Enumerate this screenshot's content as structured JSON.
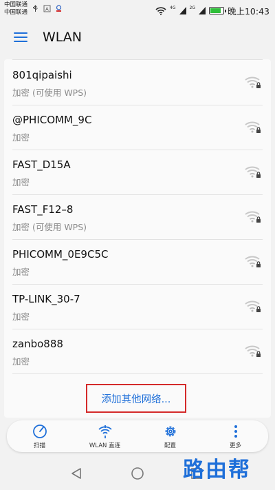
{
  "status_bar": {
    "carrier_1": "中国联通",
    "carrier_2": "中国联通",
    "signal_label_1": "4G",
    "signal_label_2": "2G",
    "time": "晚上10:43",
    "battery_level": 0.85,
    "colors": {
      "battery_fill": "#2fbf3a"
    }
  },
  "app_bar": {
    "title": "WLAN",
    "menu_icon": "hamburger-icon"
  },
  "networks": [
    {
      "ssid": "801qipaishi",
      "security": "加密 (可使用 WPS)"
    },
    {
      "ssid": "@PHICOMM_9C",
      "security": "加密"
    },
    {
      "ssid": "FAST_D15A",
      "security": "加密"
    },
    {
      "ssid": "FAST_F12–8",
      "security": "加密 (可使用 WPS)"
    },
    {
      "ssid": "PHICOMM_0E9C5C",
      "security": "加密"
    },
    {
      "ssid": "TP-LINK_30-7",
      "security": "加密"
    },
    {
      "ssid": "zanbo888",
      "security": "加密"
    }
  ],
  "add_network_label": "添加其他网络...",
  "toolbar": {
    "scan_label": "扫描",
    "direct_label": "WLAN 直连",
    "config_label": "配置",
    "more_label": "更多"
  },
  "watermark": "路由帮",
  "colors": {
    "accent": "#1e6fd9",
    "highlight_box": "#d42a2a"
  }
}
